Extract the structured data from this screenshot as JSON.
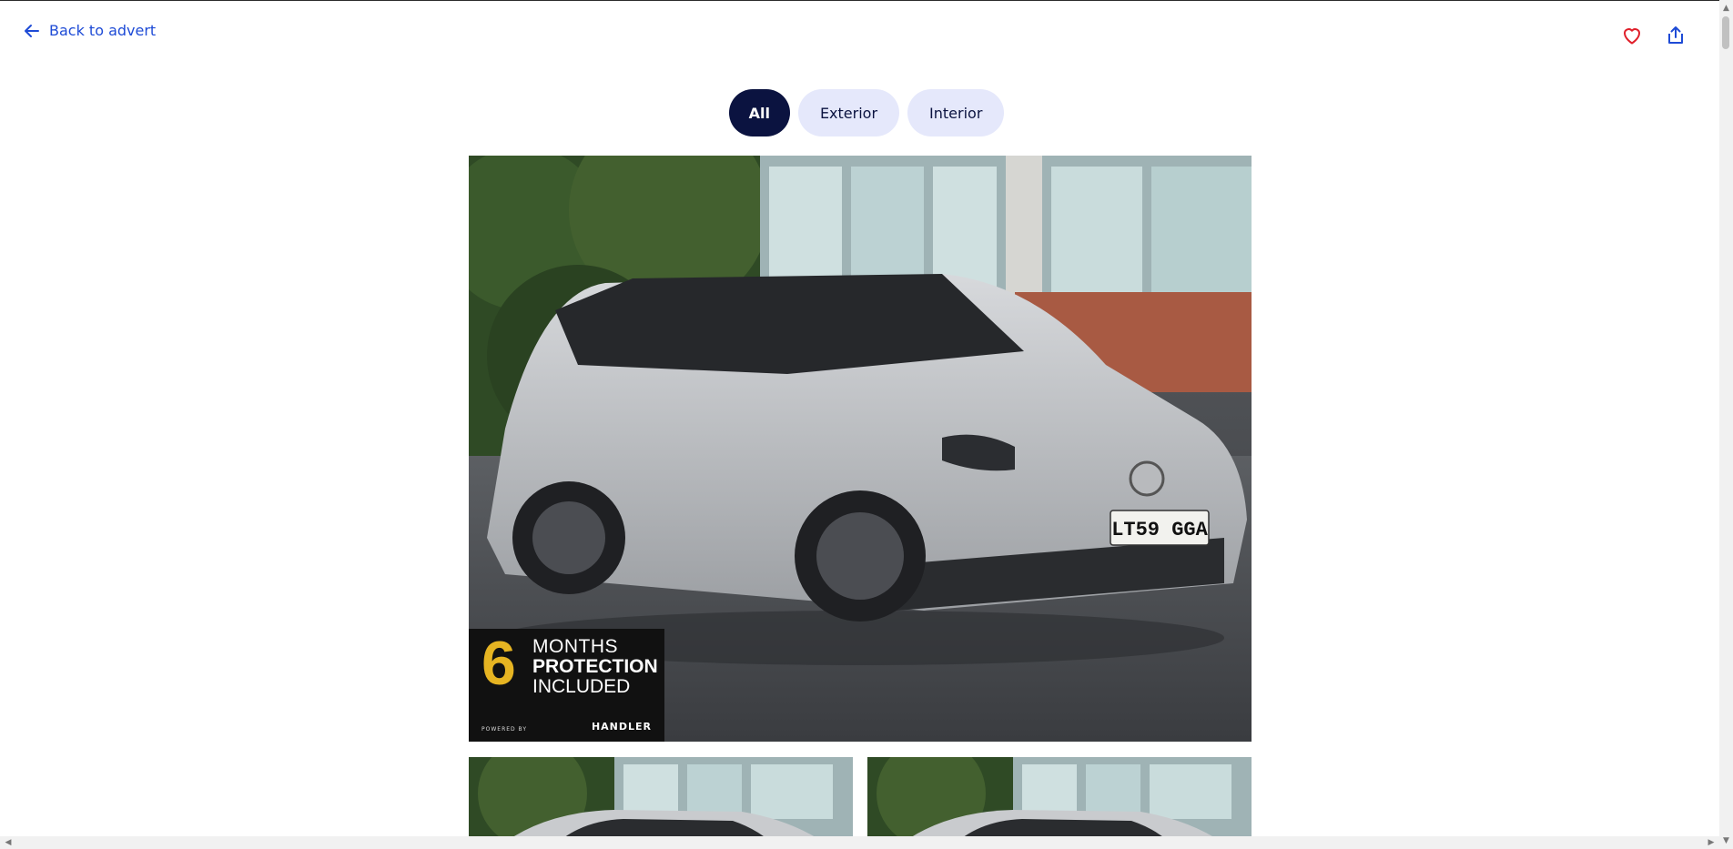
{
  "header": {
    "back_label": "Back to advert",
    "favourite_icon": "heart-icon",
    "share_icon": "share-icon",
    "heart_color": "#e0202b",
    "share_color": "#1e4bd6"
  },
  "filters": {
    "tabs": [
      {
        "label": "All",
        "active": true
      },
      {
        "label": "Exterior",
        "active": false
      },
      {
        "label": "Interior",
        "active": false
      }
    ]
  },
  "gallery": {
    "main_photo": {
      "plate": "LT59 GGA",
      "badge": {
        "number": "6",
        "line1": "MONTHS",
        "line2": "PROTECTION",
        "line3": "INCLUDED",
        "powered_by": "POWERED BY",
        "brand": "HANDLER"
      }
    }
  },
  "colors": {
    "primary": "#0b1340",
    "accent": "#1e4bd6",
    "pill_bg": "#e5e8fb"
  }
}
